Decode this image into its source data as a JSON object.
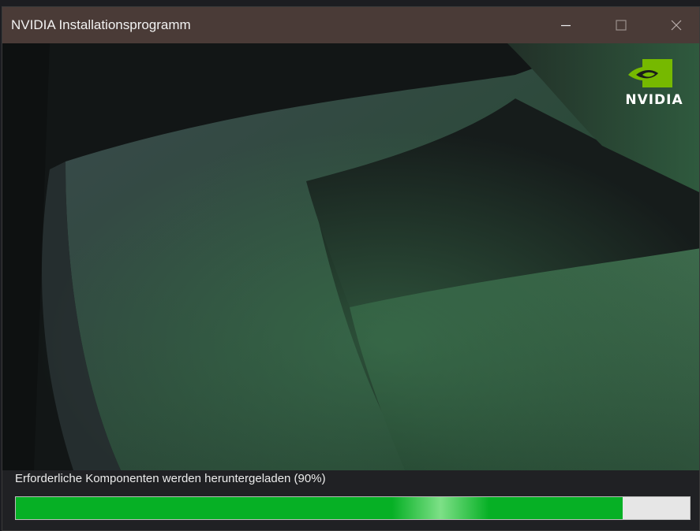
{
  "window": {
    "title": "NVIDIA Installationsprogramm",
    "controls": {
      "minimize_icon": "minimize-icon",
      "maximize_icon": "maximize-icon",
      "close_icon": "close-icon"
    }
  },
  "branding": {
    "logo_text": "NVIDIA",
    "logo_icon": "nvidia-eye-logo",
    "accent": "#76b900"
  },
  "installer": {
    "status_text": "Erforderliche Komponenten werden heruntergeladen (90%)",
    "progress_percent": 90,
    "progress_color": "#06b025"
  }
}
